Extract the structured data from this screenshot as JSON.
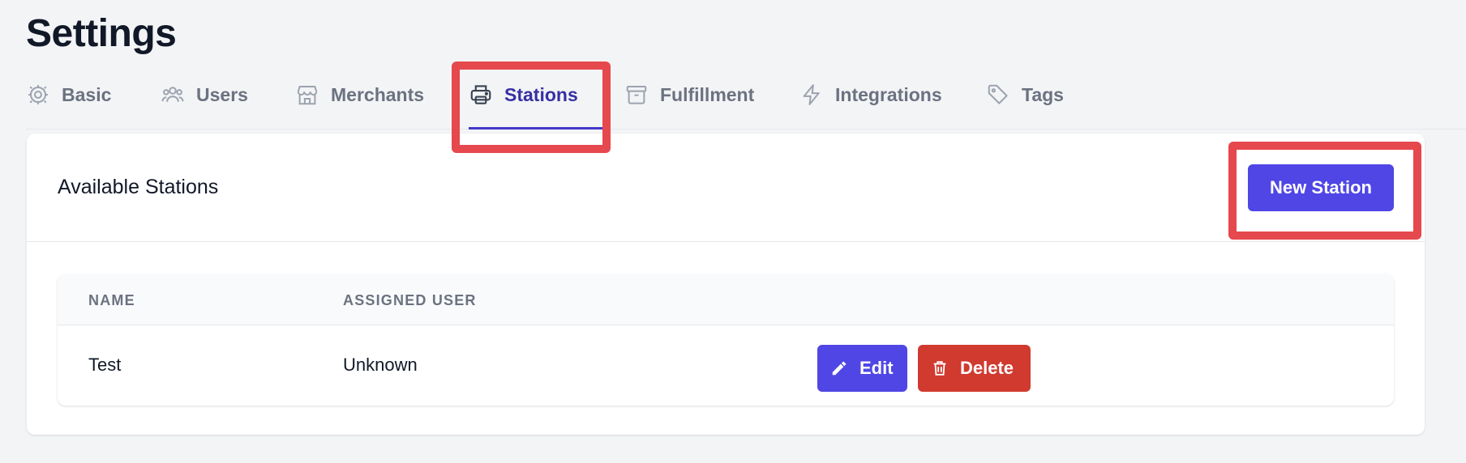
{
  "page": {
    "title": "Settings"
  },
  "tabs": [
    {
      "label": "Basic",
      "icon": "gear-icon",
      "active": false
    },
    {
      "label": "Users",
      "icon": "users-icon",
      "active": false
    },
    {
      "label": "Merchants",
      "icon": "storefront-icon",
      "active": false
    },
    {
      "label": "Stations",
      "icon": "printer-icon",
      "active": true
    },
    {
      "label": "Fulfillment",
      "icon": "archive-box-icon",
      "active": false
    },
    {
      "label": "Integrations",
      "icon": "lightning-icon",
      "active": false
    },
    {
      "label": "Tags",
      "icon": "tag-icon",
      "active": false
    }
  ],
  "colors": {
    "accent": "#4f46e5",
    "active_tab_text": "#3730a3",
    "danger": "#d03a2f",
    "highlight": "#e5484d",
    "background": "#f3f4f6"
  },
  "card": {
    "title": "Available Stations",
    "new_button_label": "New Station"
  },
  "table": {
    "columns": [
      "NAME",
      "ASSIGNED USER"
    ],
    "rows": [
      {
        "name": "Test",
        "assigned_user": "Unknown",
        "edit_label": "Edit",
        "delete_label": "Delete"
      }
    ]
  }
}
